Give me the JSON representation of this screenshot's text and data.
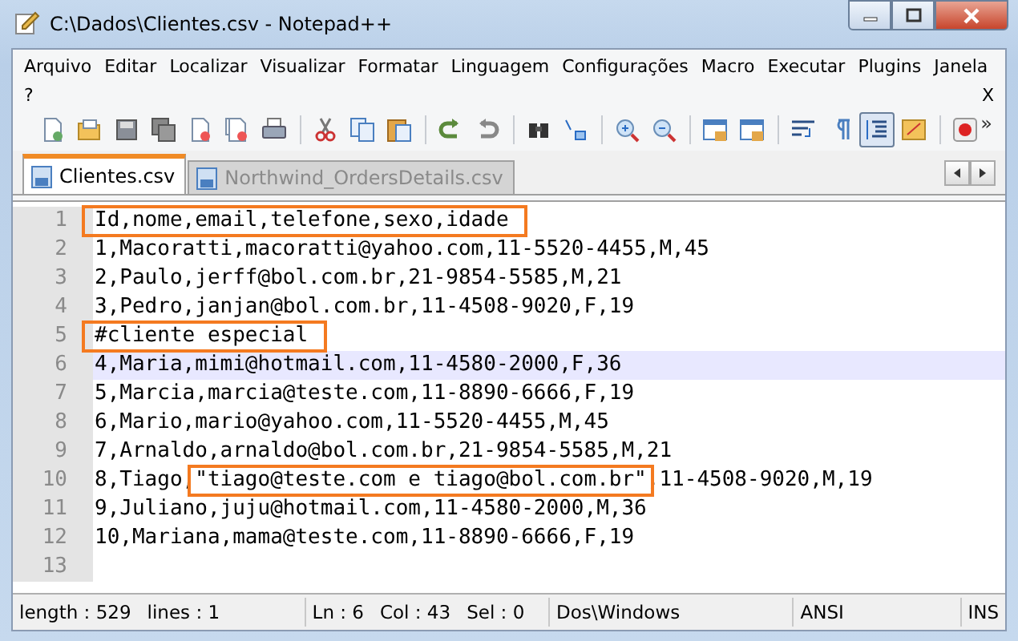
{
  "window": {
    "title": "C:\\Dados\\Clientes.csv - Notepad++"
  },
  "menu": [
    {
      "label": "Arquivo"
    },
    {
      "label": "Editar"
    },
    {
      "label": "Localizar"
    },
    {
      "label": "Visualizar"
    },
    {
      "label": "Formatar"
    },
    {
      "label": "Linguagem"
    },
    {
      "label": "Configurações"
    },
    {
      "label": "Macro"
    },
    {
      "label": "Executar"
    },
    {
      "label": "Plugins"
    },
    {
      "label": "Janela"
    },
    {
      "label": "?"
    }
  ],
  "menu_close": "X",
  "toolbar": [
    [
      {
        "kind": "new",
        "pressed": false
      },
      {
        "kind": "open",
        "pressed": false
      },
      {
        "kind": "save",
        "pressed": false
      },
      {
        "kind": "save-all",
        "pressed": false
      },
      {
        "kind": "close",
        "pressed": false
      },
      {
        "kind": "close-all",
        "pressed": false
      },
      {
        "kind": "print",
        "pressed": false
      }
    ],
    [
      {
        "kind": "cut",
        "pressed": false
      },
      {
        "kind": "copy",
        "pressed": false
      },
      {
        "kind": "paste",
        "pressed": false
      }
    ],
    [
      {
        "kind": "undo",
        "pressed": false
      },
      {
        "kind": "redo",
        "pressed": false
      }
    ],
    [
      {
        "kind": "find",
        "pressed": false
      },
      {
        "kind": "replace",
        "pressed": false
      }
    ],
    [
      {
        "kind": "zoom-in",
        "pressed": false
      },
      {
        "kind": "zoom-out",
        "pressed": false
      }
    ],
    [
      {
        "kind": "sync-vertical",
        "pressed": false
      },
      {
        "kind": "sync-horizontal",
        "pressed": false
      }
    ],
    [
      {
        "kind": "word-wrap",
        "pressed": false
      },
      {
        "kind": "show-all",
        "pressed": false
      },
      {
        "kind": "indent-guide",
        "pressed": true
      },
      {
        "kind": "doc-map",
        "pressed": false
      }
    ],
    [
      {
        "kind": "record",
        "pressed": false
      }
    ]
  ],
  "toolbar_overflow": "»",
  "tabs": [
    {
      "label": "Clientes.csv",
      "selected": true
    },
    {
      "label": "Northwind_OrdersDetails.csv",
      "selected": false
    }
  ],
  "lines": [
    {
      "number": "1",
      "current": false,
      "segments": [
        {
          "text": "Id,nome,email,telefone,sexo,idade",
          "boxed": true
        }
      ]
    },
    {
      "number": "2",
      "current": false,
      "segments": [
        {
          "text": "1,Macoratti,macoratti@yahoo.com,11-5520-4455,M,45",
          "boxed": false
        }
      ]
    },
    {
      "number": "3",
      "current": false,
      "segments": [
        {
          "text": "2,Paulo,jerff@bol.com.br,21-9854-5585,M,21",
          "boxed": false
        }
      ]
    },
    {
      "number": "4",
      "current": false,
      "segments": [
        {
          "text": "3,Pedro,janjan@bol.com.br,11-4508-9020,F,19",
          "boxed": false
        }
      ]
    },
    {
      "number": "5",
      "current": false,
      "segments": [
        {
          "text": "#cliente especial",
          "boxed": true
        }
      ]
    },
    {
      "number": "6",
      "current": true,
      "segments": [
        {
          "text": "4,Maria,mimi@hotmail.com,11-4580-2000,F,36",
          "boxed": false
        }
      ]
    },
    {
      "number": "7",
      "current": false,
      "segments": [
        {
          "text": "5,Marcia,marcia@teste.com,11-8890-6666,F,19",
          "boxed": false
        }
      ]
    },
    {
      "number": "8",
      "current": false,
      "segments": [
        {
          "text": "6,Mario,mario@yahoo.com,11-5520-4455,M,45",
          "boxed": false
        }
      ]
    },
    {
      "number": "9",
      "current": false,
      "segments": [
        {
          "text": "7,Arnaldo,arnaldo@bol.com.br,21-9854-5585,M,21",
          "boxed": false
        }
      ]
    },
    {
      "number": "10",
      "current": false,
      "segments": [
        {
          "text": "8,Tiago,",
          "boxed": false
        },
        {
          "text": "\"tiago@teste.com e tiago@bol.com.br\"",
          "boxed": true
        },
        {
          "text": ",11-4508-9020,M,19",
          "boxed": false
        }
      ]
    },
    {
      "number": "11",
      "current": false,
      "segments": [
        {
          "text": "9,Juliano,juju@hotmail.com,11-4580-2000,M,36",
          "boxed": false
        }
      ]
    },
    {
      "number": "12",
      "current": false,
      "segments": [
        {
          "text": "10,Mariana,mama@teste.com,11-8890-6666,F,19",
          "boxed": false
        }
      ]
    },
    {
      "number": "13",
      "current": false
    }
  ],
  "status_bar": [
    {
      "items": [
        "length : 529",
        "lines : 1"
      ]
    },
    {
      "items": [
        "Ln : 6",
        "Col : 43",
        "Sel : 0"
      ]
    },
    {
      "items": [
        "Dos\\Windows"
      ]
    },
    {
      "items": [
        "ANSI"
      ]
    },
    {
      "items": [
        "INS"
      ]
    }
  ]
}
